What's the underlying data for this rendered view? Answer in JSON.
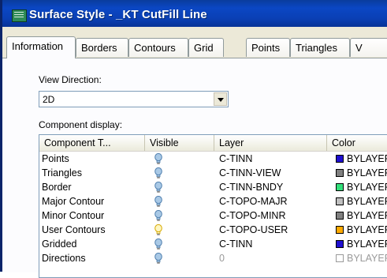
{
  "window": {
    "title": "Surface Style - _KT CutFill Line"
  },
  "tabs": [
    {
      "label": "Information",
      "active": true
    },
    {
      "label": "Borders",
      "active": false
    },
    {
      "label": "Contours",
      "active": false
    },
    {
      "label": "Grid",
      "active": false
    },
    {
      "label": "Points",
      "active": false
    },
    {
      "label": "Triangles",
      "active": false
    },
    {
      "label": "V",
      "active": false
    }
  ],
  "view_direction": {
    "label": "View Direction:",
    "selected": "2D"
  },
  "component_display": {
    "label": "Component display:",
    "columns": [
      "Component T...",
      "Visible",
      "Layer",
      "Color"
    ],
    "rows": [
      {
        "component": "Points",
        "visible": "on",
        "layer": "C-TINN",
        "color_label": "BYLAYER",
        "color": "#1f0fd0"
      },
      {
        "component": "Triangles",
        "visible": "on",
        "layer": "C-TINN-VIEW",
        "color_label": "BYLAYER",
        "color": "#808080"
      },
      {
        "component": "Border",
        "visible": "on",
        "layer": "C-TINN-BNDY",
        "color_label": "BYLAYER",
        "color": "#33e07a"
      },
      {
        "component": "Major Contour",
        "visible": "on",
        "layer": "C-TOPO-MAJR",
        "color_label": "BYLAYER",
        "color": "#c0c0c0"
      },
      {
        "component": "Minor Contour",
        "visible": "on",
        "layer": "C-TOPO-MINR",
        "color_label": "BYLAYER",
        "color": "#808080"
      },
      {
        "component": "User Contours",
        "visible": "off",
        "layer": "C-TOPO-USER",
        "color_label": "BYLAYER",
        "color": "#ffaa00"
      },
      {
        "component": "Gridded",
        "visible": "on",
        "layer": "C-TINN",
        "color_label": "BYLAYER",
        "color": "#1f0fd0"
      },
      {
        "component": "Directions",
        "visible": "on",
        "layer": "0",
        "color_label": "BYLAYER",
        "color": "#ffffff",
        "muted": true
      }
    ]
  }
}
